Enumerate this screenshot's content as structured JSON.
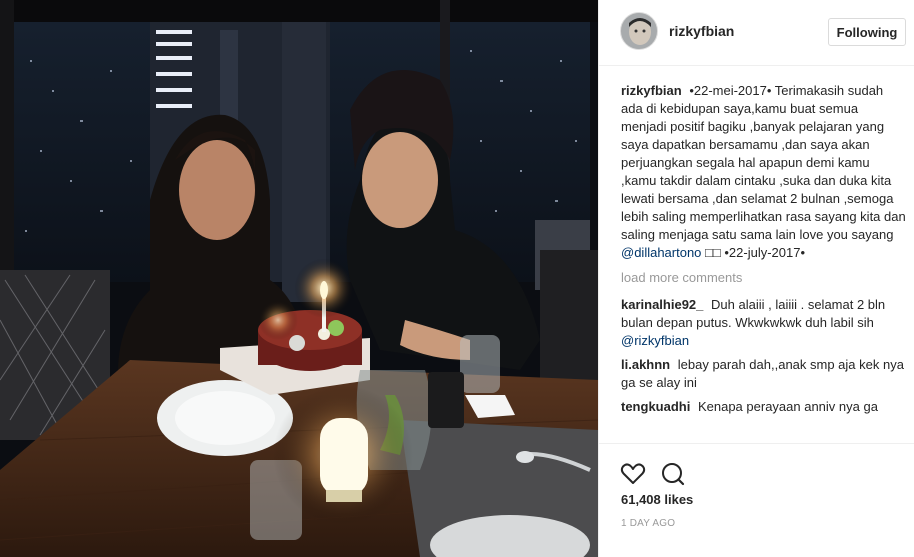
{
  "post": {
    "username": "rizkyfbian",
    "follow_label": "Following",
    "caption": {
      "username": "rizkyfbian",
      "text_main": "•22-mei-2017• Terimakasih sudah ada di kebidupan saya,kamu buat semua menjadi positif bagiku ,banyak pelajaran yang saya dapatkan bersamamu ,dan saya akan perjuangkan segala hal apapun demi kamu ,kamu takdir dalam cintaku ,suka dan duka kita lewati bersama ,dan selamat 2 bulnan ,semoga lebih saling memperlihatkan rasa sayang kita dan saling menjaga satu sama lain love you sayang",
      "mention": "@dillahartono",
      "text_end": "□□ •22-july-2017•"
    },
    "load_more": "load more comments",
    "comments": [
      {
        "username": "karinalhie92_",
        "text": "Duh alaiii , laiiii . selamat 2 bln bulan depan putus. Wkwkwkwk duh labil sih",
        "mention": "@rizkyfbian"
      },
      {
        "username": "li.akhnn",
        "text": "lebay parah dah,,anak smp aja kek nya ga se alay ini",
        "mention": ""
      },
      {
        "username": "tengkuadhi",
        "text": "Kenapa perayaan anniv nya ga",
        "mention": ""
      }
    ],
    "likes": "61,408 likes",
    "time_ago": "1 DAY AGO",
    "icons": {
      "like": "heart-icon",
      "comment": "comment-icon"
    }
  }
}
